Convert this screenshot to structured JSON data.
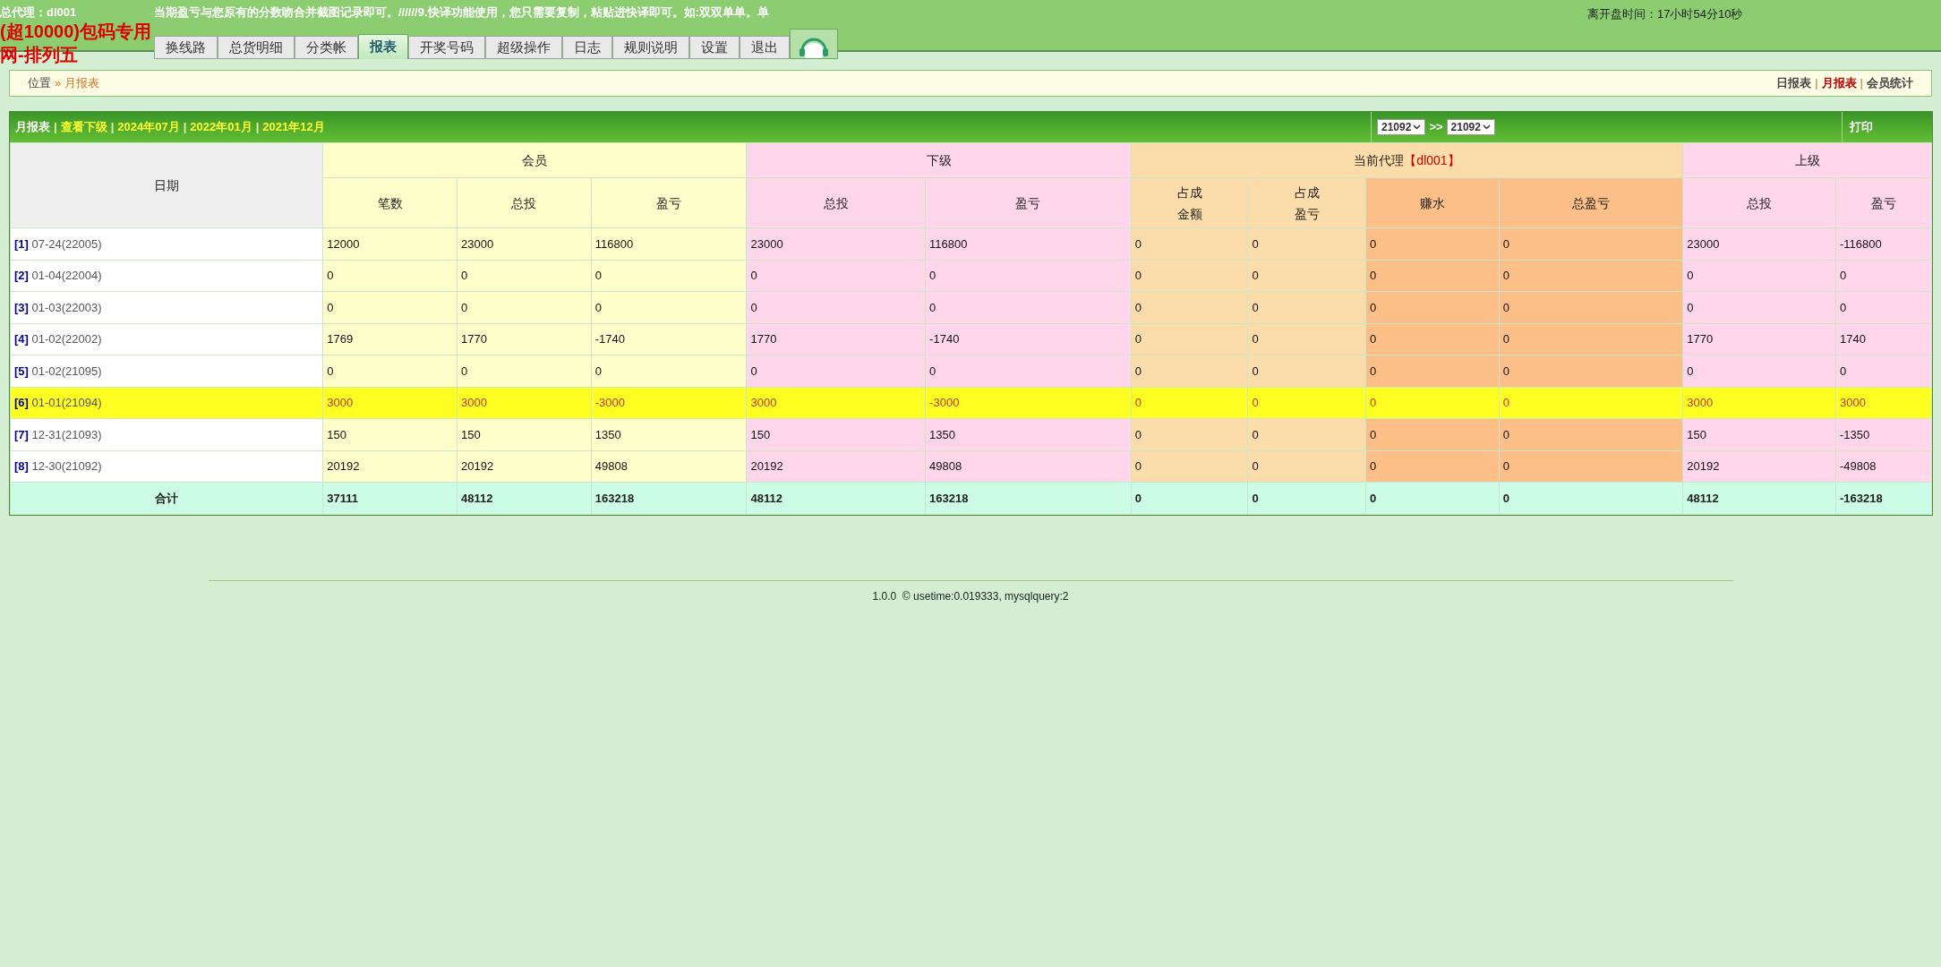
{
  "header": {
    "agent": "总代理：dl001",
    "marquee": "当期盈亏与您原有的分数吻合并截图记录即可。//////9.快译功能使用，您只需要复制，粘贴进快译即可。如:双双单单。单",
    "promo_lines": [
      "(超10000)包码专用",
      "网-排列五"
    ],
    "countdown": "离开盘时间：17小时54分10秒"
  },
  "tabs": [
    {
      "label": "换线路",
      "selected": false
    },
    {
      "label": "总货明细",
      "selected": false
    },
    {
      "label": "分类帐",
      "selected": false
    },
    {
      "label": "报表",
      "selected": true
    },
    {
      "label": "开奖号码",
      "selected": false
    },
    {
      "label": "超级操作",
      "selected": false
    },
    {
      "label": "日志",
      "selected": false
    },
    {
      "label": "规则说明",
      "selected": false
    },
    {
      "label": "设置",
      "selected": false
    },
    {
      "label": "退出",
      "selected": false
    }
  ],
  "breadcrumb": {
    "prefix": "位置",
    "separator": "»",
    "current": "月报表"
  },
  "report_link_separator": "|",
  "report_links": [
    {
      "label": "日报表",
      "selected": false
    },
    {
      "label": "月报表",
      "selected": true
    },
    {
      "label": "会员统计",
      "selected": false
    }
  ],
  "toolbar": {
    "separator": "|",
    "links": [
      {
        "label": "月报表",
        "selected": true
      },
      {
        "label": "查看下级",
        "selected": false
      },
      {
        "label": "2024年07月",
        "selected": false
      },
      {
        "label": "2022年01月",
        "selected": false
      },
      {
        "label": "2021年12月",
        "selected": false
      }
    ],
    "range_from": "21092",
    "range_separator": ">>",
    "range_to": "21092",
    "print": "打印"
  },
  "table": {
    "date_heading": "日期",
    "groups": [
      {
        "label": "会员",
        "kind": "member"
      },
      {
        "label": "下级",
        "kind": "lower"
      },
      {
        "label": "当前代理",
        "agent": "【dl001】",
        "kind": "share"
      },
      {
        "label": "上级",
        "kind": "upper"
      }
    ],
    "columns": [
      {
        "lines": [
          "笔数"
        ],
        "kind": "member"
      },
      {
        "lines": [
          "总投"
        ],
        "kind": "member"
      },
      {
        "lines": [
          "盈亏"
        ],
        "kind": "member"
      },
      {
        "lines": [
          "总投"
        ],
        "kind": "lower"
      },
      {
        "lines": [
          "盈亏"
        ],
        "kind": "lower"
      },
      {
        "lines": [
          "占成",
          "金额"
        ],
        "kind": "share"
      },
      {
        "lines": [
          "占成",
          "盈亏"
        ],
        "kind": "share"
      },
      {
        "lines": [
          "赚水"
        ],
        "kind": "rebate"
      },
      {
        "lines": [
          "总盈亏"
        ],
        "kind": "rebate"
      },
      {
        "lines": [
          "总投"
        ],
        "kind": "upper"
      },
      {
        "lines": [
          "盈亏"
        ],
        "kind": "upper"
      }
    ],
    "rows": [
      {
        "index": "[1]",
        "date": "07-24(22005)",
        "highlighted": false,
        "cells": [
          "12000",
          "23000",
          "116800",
          "23000",
          "116800",
          "0",
          "0",
          "0",
          "0",
          "23000",
          "-116800"
        ]
      },
      {
        "index": "[2]",
        "date": "01-04(22004)",
        "highlighted": false,
        "cells": [
          "0",
          "0",
          "0",
          "0",
          "0",
          "0",
          "0",
          "0",
          "0",
          "0",
          "0"
        ]
      },
      {
        "index": "[3]",
        "date": "01-03(22003)",
        "highlighted": false,
        "cells": [
          "0",
          "0",
          "0",
          "0",
          "0",
          "0",
          "0",
          "0",
          "0",
          "0",
          "0"
        ]
      },
      {
        "index": "[4]",
        "date": "01-02(22002)",
        "highlighted": false,
        "cells": [
          "1769",
          "1770",
          "-1740",
          "1770",
          "-1740",
          "0",
          "0",
          "0",
          "0",
          "1770",
          "1740"
        ]
      },
      {
        "index": "[5]",
        "date": "01-02(21095)",
        "highlighted": false,
        "cells": [
          "0",
          "0",
          "0",
          "0",
          "0",
          "0",
          "0",
          "0",
          "0",
          "0",
          "0"
        ]
      },
      {
        "index": "[6]",
        "date": "01-01(21094)",
        "highlighted": true,
        "cells": [
          "3000",
          "3000",
          "-3000",
          "3000",
          "-3000",
          "0",
          "0",
          "0",
          "0",
          "3000",
          "3000"
        ]
      },
      {
        "index": "[7]",
        "date": "12-31(21093)",
        "highlighted": false,
        "cells": [
          "150",
          "150",
          "1350",
          "150",
          "1350",
          "0",
          "0",
          "0",
          "0",
          "150",
          "-1350"
        ]
      },
      {
        "index": "[8]",
        "date": "12-30(21092)",
        "highlighted": false,
        "cells": [
          "20192",
          "20192",
          "49808",
          "20192",
          "49808",
          "0",
          "0",
          "0",
          "0",
          "20192",
          "-49808"
        ]
      }
    ],
    "total": {
      "label": "合计",
      "cells": [
        "37111",
        "48112",
        "163218",
        "48112",
        "163218",
        "0",
        "0",
        "0",
        "0",
        "48112",
        "-163218"
      ]
    }
  },
  "footer": "1.0.0  © usetime:0.019333, mysqlquery:2"
}
